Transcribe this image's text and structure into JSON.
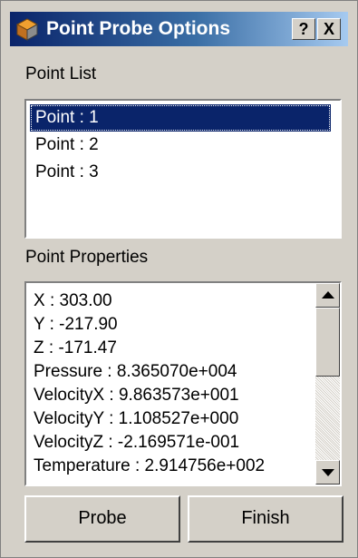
{
  "window": {
    "title": "Point Probe Options",
    "help_label": "?",
    "close_label": "X"
  },
  "point_list": {
    "label": "Point List",
    "items": [
      "Point : 1",
      "Point : 2",
      "Point : 3"
    ],
    "selected_index": 0
  },
  "point_properties": {
    "label": "Point Properties",
    "lines": [
      "X : 303.00",
      "Y : -217.90",
      "Z : -171.47",
      "Pressure : 8.365070e+004",
      "VelocityX : 9.863573e+001",
      "VelocityY : 1.108527e+000",
      "VelocityZ : -2.169571e-001",
      "Temperature : 2.914756e+002"
    ]
  },
  "buttons": {
    "probe": "Probe",
    "finish": "Finish"
  },
  "icons": {
    "app": "cube-icon",
    "scroll_up": "arrow-up-icon",
    "scroll_down": "arrow-down-icon"
  },
  "colors": {
    "title_bar_start": "#0a246a",
    "title_bar_end": "#a6caf0",
    "selection": "#0a246a",
    "dialog_face": "#d4d0c8"
  }
}
